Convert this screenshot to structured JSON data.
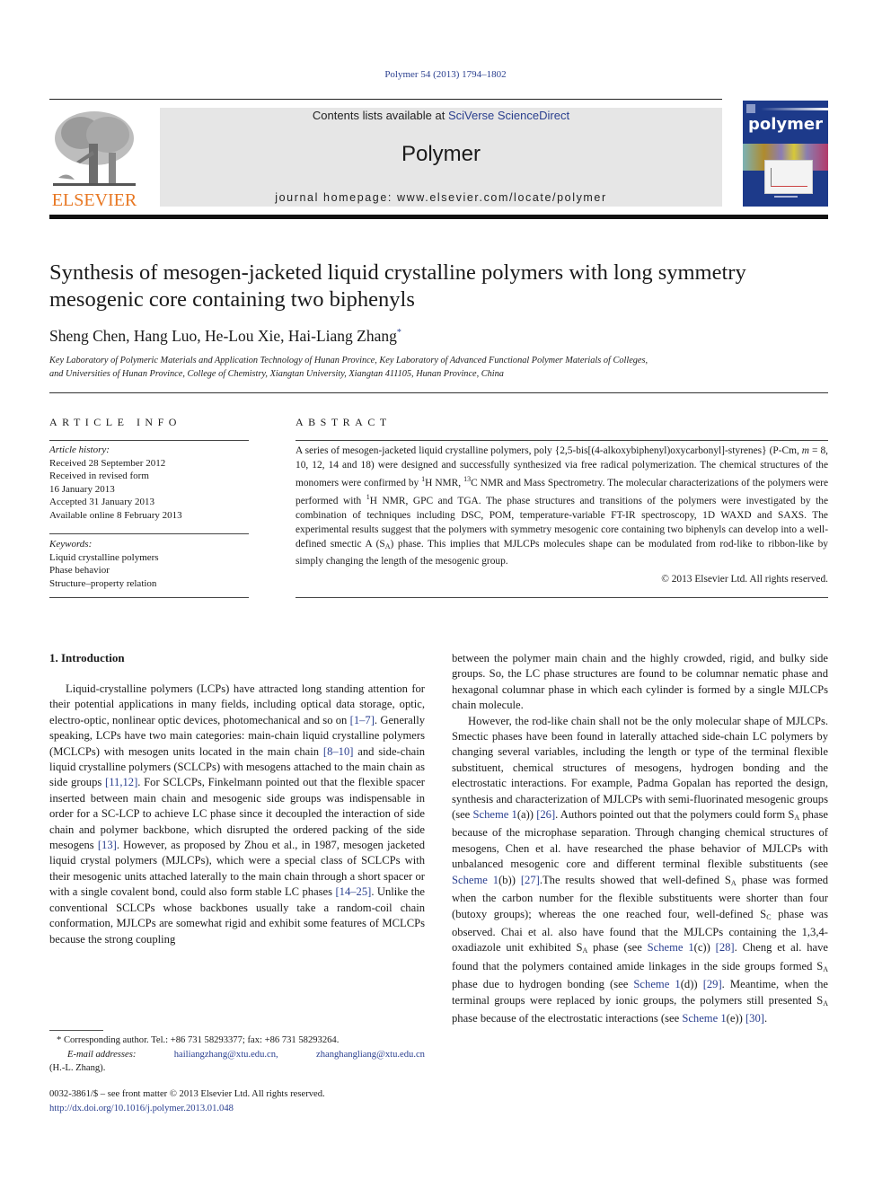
{
  "running_head": "Polymer 54 (2013) 1794–1802",
  "banner": {
    "contents_prefix": "Contents lists available at ",
    "contents_link": "SciVerse ScienceDirect",
    "journal": "Polymer",
    "homepage": "journal homepage: www.elsevier.com/locate/polymer"
  },
  "publisher_logo_text": "ELSEVIER",
  "cover_word": "polymer",
  "colors": {
    "link": "#2a3f8f",
    "elsevier_orange": "#e87722",
    "banner_bg": "#e6e6e6",
    "cover_blue": "#1d3a8a"
  },
  "article": {
    "title": "Synthesis of mesogen-jacketed liquid crystalline polymers with long symmetry mesogenic core containing two biphenyls",
    "authors": "Sheng Chen, Hang Luo, He-Lou Xie, Hai-Liang Zhang",
    "corresponding_mark": "*",
    "affiliation_line1": "Key Laboratory of Polymeric Materials and Application Technology of Hunan Province, Key Laboratory of Advanced Functional Polymer Materials of Colleges,",
    "affiliation_line2": "and Universities of Hunan Province, College of Chemistry, Xiangtan University, Xiangtan 411105, Hunan Province, China"
  },
  "article_info": {
    "heading": "ARTICLE INFO",
    "history_label": "Article history:",
    "history": [
      "Received 28 September 2012",
      "Received in revised form",
      "16 January 2013",
      "Accepted 31 January 2013",
      "Available online 8 February 2013"
    ],
    "keywords_label": "Keywords:",
    "keywords": [
      "Liquid crystalline polymers",
      "Phase behavior",
      "Structure–property relation"
    ]
  },
  "abstract": {
    "heading": "ABSTRACT",
    "p1": "A series of mesogen-jacketed liquid crystalline polymers, poly {2,5-bis[(4-alkoxybiphenyl)oxycarbonyl]-styrenes} (P-Cm, ",
    "m_var": "m",
    "p2": " = 8, 10, 12, 14 and 18) were designed and successfully synthesized via free radical polymerization. The chemical structures of the monomers were confirmed by ",
    "sup1": "1",
    "p3": "H NMR, ",
    "sup2": "13",
    "p4": "C NMR and Mass Spectrometry. The molecular characterizations of the polymers were performed with ",
    "sup3": "1",
    "p5": "H NMR, GPC and TGA. The phase structures and transitions of the polymers were investigated by the combination of techniques including DSC, POM, temperature-variable FT-IR spectroscopy, 1D WAXD and SAXS. The experimental results suggest that the polymers with symmetry mesogenic core containing two biphenyls can develop into a well-defined smectic A (S",
    "sub_a": "A",
    "p6": ") phase. This implies that MJLCPs molecules shape can be modulated from rod-like to ribbon-like by simply changing the length of the mesogenic group.",
    "copyright": "© 2013 Elsevier Ltd. All rights reserved."
  },
  "intro": {
    "heading": "1.  Introduction",
    "left_p1_a": "Liquid-crystalline polymers (LCPs) have attracted long standing attention for their potential applications in many fields, including optical data storage, optic, electro-optic, nonlinear optic devices, photomechanical and so on ",
    "ref_1_7": "[1–7]",
    "left_p1_b": ". Generally speaking, LCPs have two main categories: main-chain liquid crystalline polymers (MCLCPs) with mesogen units located in the main chain ",
    "ref_8_10": "[8–10]",
    "left_p1_c": " and side-chain liquid crystalline polymers (SCLCPs) with mesogens attached to the main chain as side groups ",
    "ref_11_12": "[11,12]",
    "left_p1_d": ". For SCLCPs, Finkelmann pointed out that the flexible spacer inserted between main chain and mesogenic side groups was indispensable in order for a SC-LCP to achieve LC phase since it decoupled the interaction of side chain and polymer backbone, which disrupted the ordered packing of the side mesogens ",
    "ref_13": "[13]",
    "left_p1_e": ". However, as proposed by Zhou et al., in 1987, mesogen jacketed liquid crystal polymers (MJLCPs), which were a special class of SCLCPs with their mesogenic units attached laterally to the main chain through a short spacer or with a single covalent bond, could also form stable LC phases ",
    "ref_14_25": "[14–25]",
    "left_p1_f": ". Unlike the conventional SCLCPs whose backbones usually take a random-coil chain conformation, MJLCPs are somewhat rigid and exhibit some features of MCLCPs because the strong coupling",
    "right_p1": "between the polymer main chain and the highly crowded, rigid, and bulky side groups. So, the LC phase structures are found to be columnar nematic phase and hexagonal columnar phase in which each cylinder is formed by a single MJLCPs chain molecule.",
    "right_p2_a": "However, the rod-like chain shall not be the only molecular shape of MJLCPs. Smectic phases have been found in laterally attached side-chain LC polymers by changing several variables, including the length or type of the terminal flexible substituent, chemical structures of mesogens, hydrogen bonding and the electrostatic interactions. For example, Padma Gopalan has reported the design, synthesis and characterization of MJLCPs with semi-fluorinated mesogenic groups (see ",
    "scheme_a": "Scheme 1",
    "right_p2_b": "(a)) ",
    "ref_26": "[26]",
    "right_p2_c": ". Authors pointed out that the polymers could form S",
    "right_p2_d": " phase because of the microphase separation. Through changing chemical structures of mesogens, Chen et al. have researched the phase behavior of MJLCPs with unbalanced mesogenic core and different terminal flexible substituents (see ",
    "scheme_b": "Scheme 1",
    "right_p2_e": "(b)) ",
    "ref_27": "[27]",
    "right_p2_f": ".The results showed that well-defined S",
    "right_p2_g": " phase was formed when the carbon number for the flexible substituents were shorter than four (butoxy groups); whereas the one reached four, well-defined S",
    "sub_c": "C",
    "right_p2_h": " phase was observed. Chai et al. also have found that the MJLCPs containing the 1,3,4-oxadiazole unit exhibited S",
    "right_p2_i": " phase (see ",
    "scheme_c": "Scheme 1",
    "right_p2_j": "(c)) ",
    "ref_28": "[28]",
    "right_p2_k": ". Cheng et al. have found that the polymers contained amide linkages in the side groups formed S",
    "right_p2_l": " phase due to hydrogen bonding (see ",
    "scheme_d": "Scheme 1",
    "right_p2_m": "(d)) ",
    "ref_29": "[29]",
    "right_p2_n": ". Meantime, when the terminal groups were replaced by ionic groups, the polymers still presented S",
    "right_p2_o": " phase because of the electrostatic interactions (see ",
    "scheme_e": "Scheme 1",
    "right_p2_p": "(e)) ",
    "ref_30": "[30]",
    "right_p2_q": ".",
    "sub_a": "A"
  },
  "footnote": {
    "line1": "* Corresponding author. Tel.: +86 731 58293377; fax: +86 731 58293264.",
    "email_label": "E-mail addresses:",
    "email1": "hailiangzhang@xtu.edu.cn,",
    "email2": "zhanghangliang@xtu.edu.cn",
    "owner": "(H.-L. Zhang)."
  },
  "issn_line": "0032-3861/$ – see front matter © 2013 Elsevier Ltd. All rights reserved.",
  "doi": "http://dx.doi.org/10.1016/j.polymer.2013.01.048"
}
